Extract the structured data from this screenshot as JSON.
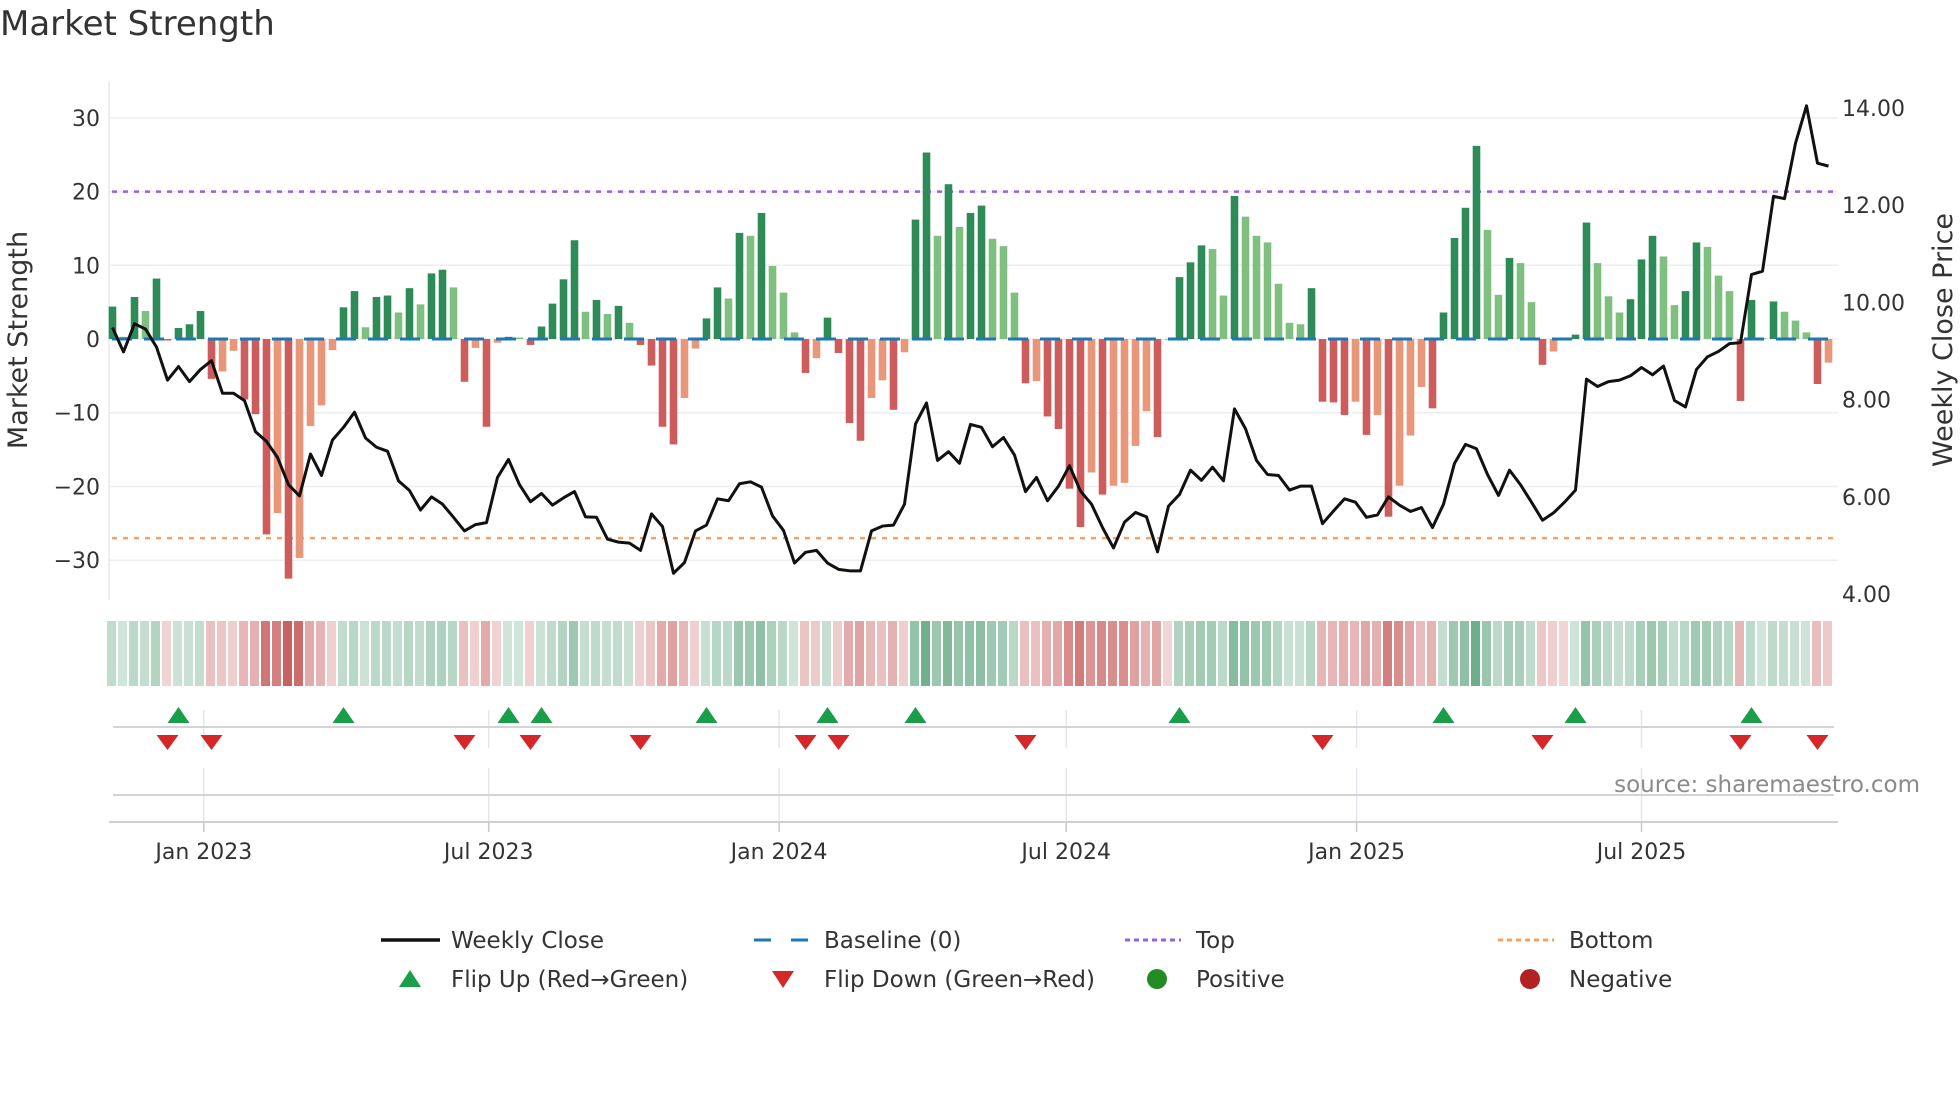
{
  "chart_data": {
    "type": "bar+line",
    "title": "Market Strength",
    "ylabel": "Market Strength",
    "y2label": "Weekly Close Price",
    "ylim": [
      -35.4,
      35
    ],
    "y2lim": [
      3.88,
      14.55
    ],
    "yticks": [
      "−30",
      "−20",
      "−10",
      "0",
      "10",
      "20",
      "30"
    ],
    "ytick_values": [
      -30,
      -20,
      -10,
      0,
      10,
      20,
      30
    ],
    "y2ticks": [
      "4.00",
      "6.00",
      "8.00",
      "10.00",
      "12.00",
      "14.00"
    ],
    "y2tick_values": [
      4,
      6,
      8,
      10,
      12,
      14
    ],
    "xticks": [
      {
        "label": "Jan 2023",
        "week": 8.3
      },
      {
        "label": "Jul 2023",
        "week": 34.2
      },
      {
        "label": "Jan 2024",
        "week": 60.6
      },
      {
        "label": "Jul 2024",
        "week": 86.7
      },
      {
        "label": "Jan 2025",
        "week": 113.1
      },
      {
        "label": "Jul 2025",
        "week": 139.0
      }
    ],
    "top_level": 20,
    "bottom_level": -27,
    "baseline": 0,
    "strength": [
      4.4,
      0.3,
      5.7,
      3.8,
      8.2,
      -0.2,
      1.5,
      2.0,
      3.8,
      -5.4,
      -4.4,
      -1.6,
      -8.2,
      -10.2,
      -26.5,
      -23.6,
      -32.5,
      -29.7,
      -11.8,
      -9.0,
      -1.5,
      4.3,
      6.5,
      1.6,
      5.7,
      5.9,
      3.6,
      6.9,
      4.7,
      8.9,
      9.4,
      7.0,
      -5.8,
      -1.2,
      -11.9,
      -0.5,
      0.3,
      0.2,
      -0.8,
      1.7,
      4.8,
      8.1,
      13.4,
      3.7,
      5.3,
      3.4,
      4.5,
      2.2,
      -0.8,
      -3.6,
      -11.9,
      -14.3,
      -8.0,
      -1.3,
      2.8,
      7.0,
      5.5,
      14.4,
      14.0,
      17.1,
      9.9,
      6.3,
      0.9,
      -4.6,
      -2.6,
      2.9,
      -1.9,
      -11.4,
      -13.8,
      -8.0,
      -5.6,
      -9.6,
      -1.8,
      16.2,
      25.3,
      14.0,
      21.0,
      15.2,
      17.1,
      18.1,
      13.6,
      12.6,
      6.3,
      -6.0,
      -5.7,
      -10.5,
      -12.2,
      -20.3,
      -25.5,
      -18.1,
      -21.1,
      -19.9,
      -19.5,
      -14.5,
      -9.8,
      -13.3,
      -0.1,
      8.4,
      10.4,
      12.7,
      12.2,
      5.9,
      19.4,
      16.6,
      14.0,
      13.1,
      7.5,
      2.2,
      2.0,
      6.9,
      -8.5,
      -8.6,
      -10.3,
      -8.5,
      -13.0,
      -10.3,
      -24.1,
      -19.9,
      -13.1,
      -6.5,
      -9.4,
      3.6,
      13.7,
      17.8,
      26.2,
      14.8,
      6.0,
      11.0,
      10.3,
      5.0,
      -3.5,
      -1.7,
      -0.1,
      0.6,
      15.8,
      10.3,
      5.8,
      3.6,
      5.4,
      10.8,
      14.0,
      11.2,
      4.6,
      6.5,
      13.1,
      12.5,
      8.6,
      6.5,
      -8.4,
      5.3,
      0.1,
      5.1,
      3.7,
      2.5,
      0.9,
      -6.1,
      -3.2
    ],
    "weekly_close": [
      9.48,
      8.98,
      9.56,
      9.45,
      9.08,
      8.4,
      8.68,
      8.37,
      8.62,
      8.8,
      8.13,
      8.13,
      7.98,
      7.34,
      7.14,
      6.81,
      6.25,
      6.02,
      6.88,
      6.44,
      7.17,
      7.43,
      7.74,
      7.21,
      7.02,
      6.94,
      6.33,
      6.13,
      5.73,
      6.0,
      5.85,
      5.58,
      5.3,
      5.43,
      5.47,
      6.4,
      6.77,
      6.25,
      5.9,
      6.07,
      5.83,
      5.98,
      6.11,
      5.59,
      5.58,
      5.13,
      5.07,
      5.05,
      4.9,
      5.65,
      5.39,
      4.43,
      4.65,
      5.3,
      5.42,
      5.96,
      5.92,
      6.27,
      6.31,
      6.2,
      5.61,
      5.31,
      4.64,
      4.86,
      4.9,
      4.64,
      4.51,
      4.48,
      4.48,
      5.3,
      5.4,
      5.42,
      5.85,
      7.5,
      7.93,
      6.75,
      6.93,
      6.69,
      7.49,
      7.43,
      7.03,
      7.22,
      6.86,
      6.11,
      6.4,
      5.92,
      6.22,
      6.64,
      6.12,
      5.85,
      5.37,
      4.95,
      5.48,
      5.68,
      5.59,
      4.87,
      5.81,
      6.05,
      6.55,
      6.34,
      6.61,
      6.33,
      7.81,
      7.4,
      6.75,
      6.46,
      6.44,
      6.14,
      6.22,
      6.22,
      5.45,
      5.71,
      5.96,
      5.89,
      5.58,
      5.63,
      6.0,
      5.83,
      5.7,
      5.78,
      5.37,
      5.85,
      6.69,
      7.08,
      6.99,
      6.46,
      6.03,
      6.55,
      6.25,
      5.89,
      5.52,
      5.67,
      5.89,
      6.14,
      8.42,
      8.27,
      8.37,
      8.4,
      8.49,
      8.66,
      8.51,
      8.69,
      7.98,
      7.85,
      8.62,
      8.88,
      8.99,
      9.15,
      9.17,
      10.57,
      10.64,
      12.18,
      12.13,
      13.27,
      14.04,
      12.86,
      12.8
    ],
    "flip_up_weeks": [
      6,
      21,
      36,
      39,
      54,
      65,
      73,
      97,
      121,
      133,
      149
    ],
    "flip_down_weeks": [
      5,
      9,
      32,
      38,
      48,
      63,
      66,
      83,
      110,
      130,
      148,
      155
    ],
    "colors": {
      "positive_rising": "#2e8b57",
      "positive_falling": "#7fbf7f",
      "negative_falling": "#cd5c5c",
      "negative_rising": "#e9967a",
      "baseline": "#1f77b4",
      "top": "#9b5de5",
      "bottom": "#f4a460",
      "line": "#111111",
      "flip_up": "#1a9e4a",
      "flip_down": "#d62728",
      "positive": "#228b22",
      "negative": "#b22222"
    },
    "legend": [
      {
        "label": "Weekly Close",
        "kind": "line"
      },
      {
        "label": "Baseline (0)",
        "kind": "dash"
      },
      {
        "label": "Top",
        "kind": "dot-top"
      },
      {
        "label": "Bottom",
        "kind": "dot-bottom"
      },
      {
        "label": "Flip Up (Red→Green)",
        "kind": "tri-up"
      },
      {
        "label": "Flip Down (Green→Red)",
        "kind": "tri-down"
      },
      {
        "label": "Positive",
        "kind": "circle-pos"
      },
      {
        "label": "Negative",
        "kind": "circle-neg"
      }
    ],
    "legend_position": "bottom",
    "source": "source: sharemaestro.com"
  }
}
